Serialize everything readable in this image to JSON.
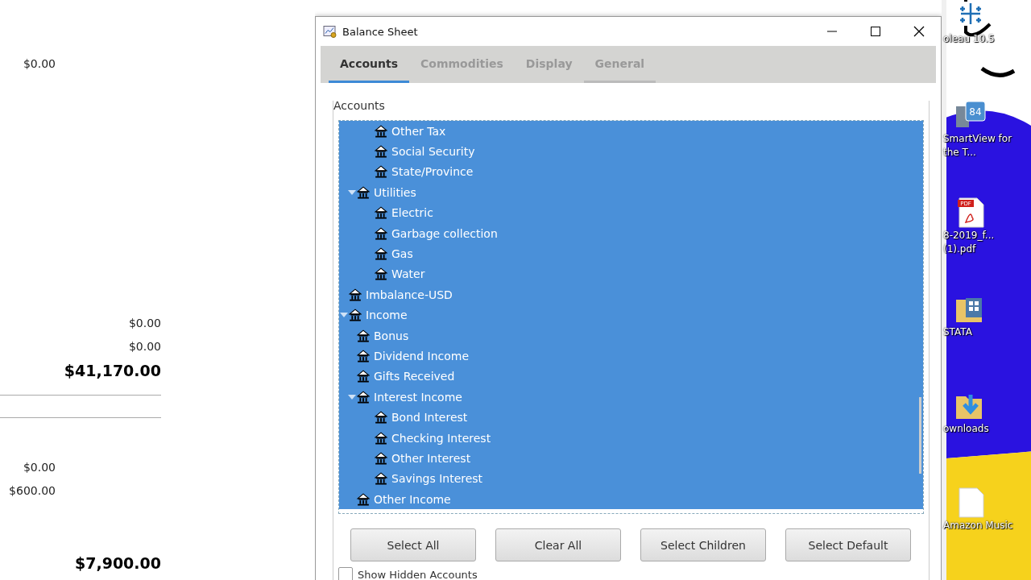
{
  "report": {
    "amounts": [
      {
        "text": "$0.00",
        "kind": "amount"
      },
      {
        "text": "$0.00",
        "kind": "amount"
      },
      {
        "text": "$0.00",
        "kind": "amount"
      },
      {
        "text": "$41,170.00",
        "kind": "total"
      },
      {
        "text": "$0.00",
        "kind": "amount"
      },
      {
        "text": "$600.00",
        "kind": "amount"
      },
      {
        "text": "$7,900.00",
        "kind": "total"
      }
    ]
  },
  "window": {
    "title": "Balance Sheet"
  },
  "tabs": [
    {
      "label": "Accounts",
      "selected": true
    },
    {
      "label": "Commodities",
      "selected": false
    },
    {
      "label": "Display",
      "selected": false
    },
    {
      "label": "General",
      "selected": false
    }
  ],
  "accounts": {
    "label": "Accounts",
    "tree": [
      {
        "children": [
          {
            "children": [
              {
                "label": "Other Tax",
                "selected": true
              },
              {
                "label": "Social Security",
                "selected": true
              },
              {
                "label": "State/Province",
                "selected": true
              }
            ]
          },
          {
            "label": "Utilities",
            "selected": true,
            "expanded": true,
            "children": [
              {
                "label": "Electric",
                "selected": true
              },
              {
                "label": "Garbage collection",
                "selected": true
              },
              {
                "label": "Gas",
                "selected": true
              },
              {
                "label": "Water",
                "selected": true
              }
            ]
          }
        ]
      },
      {
        "label": "Imbalance-USD",
        "selected": true
      },
      {
        "label": "Income",
        "selected": true,
        "expanded": true,
        "children": [
          {
            "label": "Bonus",
            "selected": true
          },
          {
            "label": "Dividend Income",
            "selected": true
          },
          {
            "label": "Gifts Received",
            "selected": true
          },
          {
            "label": "Interest Income",
            "selected": true,
            "expanded": true,
            "children": [
              {
                "label": "Bond Interest",
                "selected": true
              },
              {
                "label": "Checking Interest",
                "selected": true
              },
              {
                "label": "Other Interest",
                "selected": true
              },
              {
                "label": "Savings Interest",
                "selected": true
              }
            ]
          },
          {
            "label": "Other Income",
            "selected": true
          }
        ]
      }
    ]
  },
  "buttons": [
    "Select All",
    "Clear All",
    "Select Children",
    "Select Default"
  ],
  "show_hidden": {
    "label": "Show Hidden Accounts",
    "checked": false
  },
  "desktop": [
    {
      "label": "oleau 10.5",
      "kind": "grid"
    },
    {
      "label": "SmartView for the T...",
      "kind": "badge",
      "badge": "84"
    },
    {
      "label": "8-2019_f... (1).pdf",
      "kind": "pdf",
      "badge": "PDF"
    },
    {
      "label": "STATA",
      "kind": "folder"
    },
    {
      "label": "ownloads",
      "kind": "download"
    },
    {
      "label": "Amazon Music",
      "kind": "file"
    }
  ]
}
